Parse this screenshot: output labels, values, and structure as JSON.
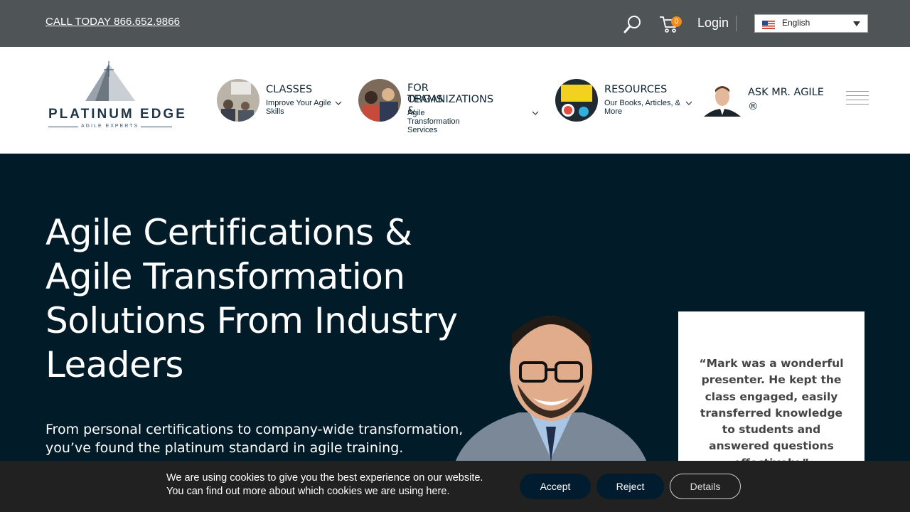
{
  "topbar": {
    "call": "CALL TODAY 866.652.9866",
    "cart_count": "0",
    "login": "Login",
    "language": "English"
  },
  "logo": {
    "word": "PLATINUM EDGE",
    "sub": "AGILE EXPERTS"
  },
  "nav": {
    "classes": {
      "title": "CLASSES",
      "sub": "Improve Your Agile Skills"
    },
    "teams": {
      "title_line1": "FOR TEAMS &",
      "title_line2": "ORGANIZATIONS",
      "sub": "Agile Transformation Services"
    },
    "resources": {
      "title": "RESOURCES",
      "sub": "Our Books, Articles, & More"
    },
    "ask": {
      "title": "ASK MR. AGILE ®"
    }
  },
  "hero": {
    "title": "Agile Certifications & Agile Transformation Solutions From Industry Leaders",
    "subtitle": "From personal certifications to company-wide transformation, you’ve found the platinum standard in agile training."
  },
  "testimonial": {
    "quote": "“Mark was a wonderful presenter. He kept the class engaged, easily transferred knowledge to students and answered questions effectively.”"
  },
  "cookie": {
    "line1": "We are using cookies to give you the best experience on our website.",
    "line2_prefix": "You can find out more about which cookies we are using",
    "line2_link": "here",
    "accept": "Accept",
    "reject": "Reject",
    "details": "Details"
  },
  "colors": {
    "topbar": "#4f5457",
    "hero_bg": "#011c28",
    "accent_orange": "#f28c1c",
    "button_dark": "#011c2f"
  }
}
